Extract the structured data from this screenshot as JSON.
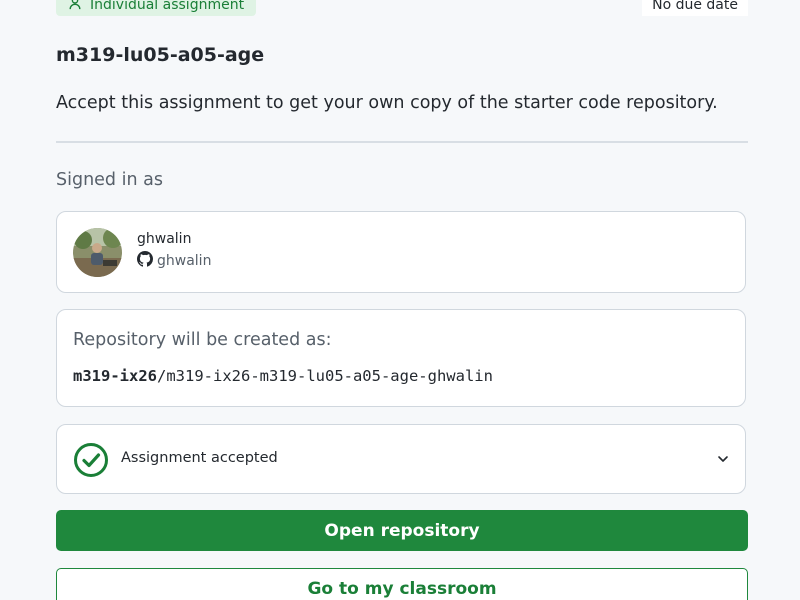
{
  "header": {
    "assignment_type": "Individual assignment",
    "due_date": "No due date"
  },
  "assignment": {
    "title": "m319-lu05-a05-age",
    "description": "Accept this assignment to get your own copy of the starter code repository."
  },
  "signed_in": {
    "label": "Signed in as",
    "display_name": "ghwalin",
    "github_handle": "ghwalin"
  },
  "repository": {
    "label": "Repository will be created as:",
    "org": "m319-ix26",
    "separator": "/",
    "name": "m319-ix26-m319-lu05-a05-age-ghwalin"
  },
  "status": {
    "label": "Assignment accepted"
  },
  "actions": {
    "open_repository": "Open repository",
    "go_to_classroom": "Go to my classroom"
  },
  "colors": {
    "accent_green": "#1f883d",
    "badge_bg": "#dff3e4",
    "page_bg": "#f6f8fa"
  }
}
